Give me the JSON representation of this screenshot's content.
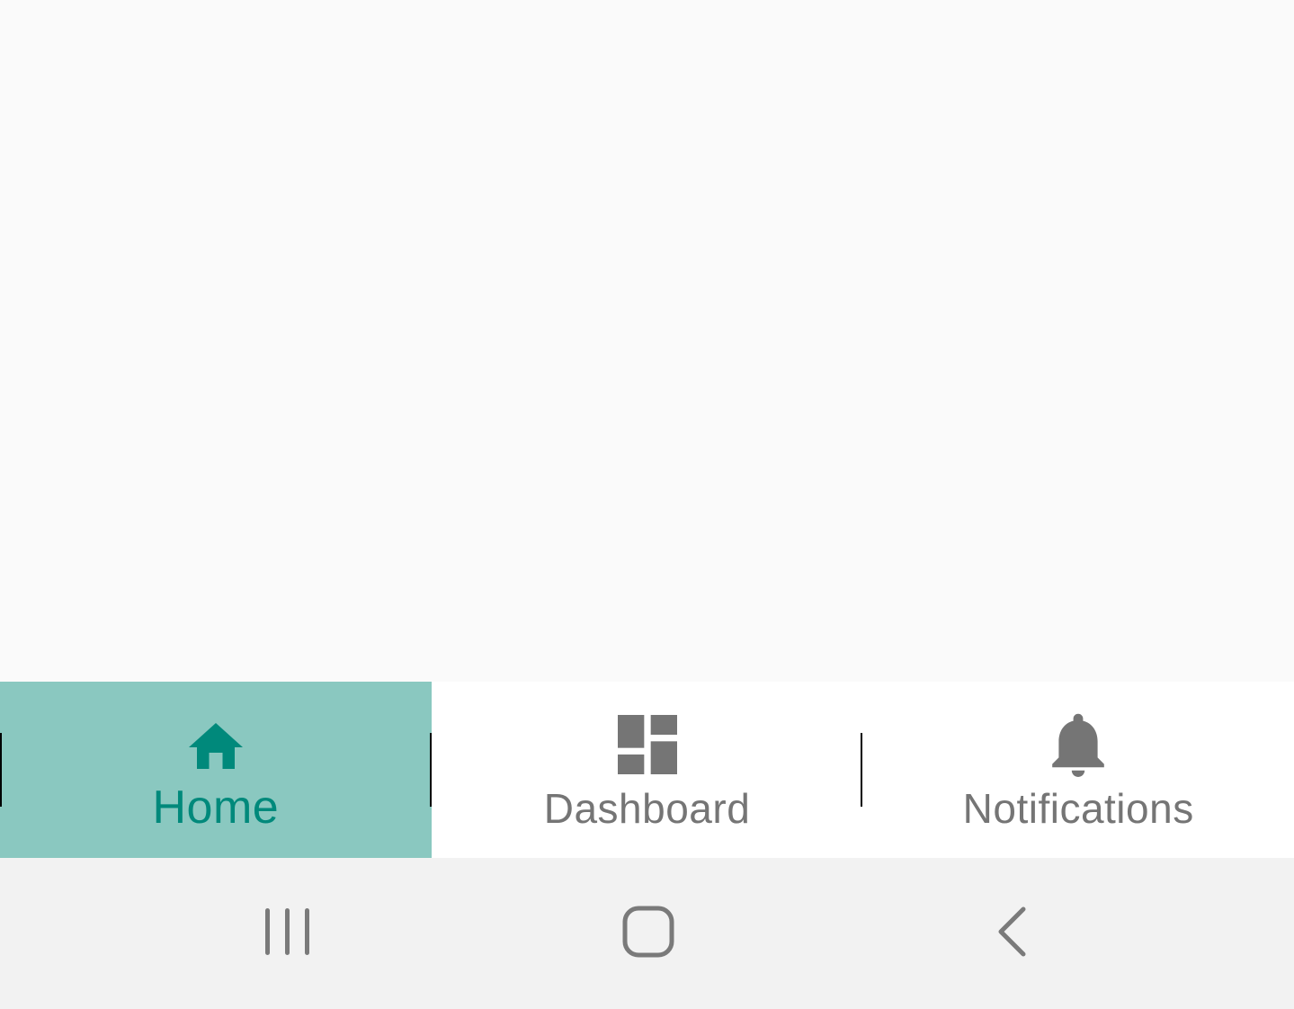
{
  "bottom_nav": {
    "items": [
      {
        "label": "Home",
        "icon": "home-icon",
        "active": true
      },
      {
        "label": "Dashboard",
        "icon": "dashboard-icon",
        "active": false
      },
      {
        "label": "Notifications",
        "icon": "bell-icon",
        "active": false
      }
    ],
    "active_color": "#00897b",
    "active_bg": "#8ac8c0",
    "inactive_color": "#757575"
  },
  "system_nav": {
    "buttons": [
      {
        "icon": "recent-apps-icon"
      },
      {
        "icon": "home-outline-icon"
      },
      {
        "icon": "back-icon"
      }
    ]
  }
}
